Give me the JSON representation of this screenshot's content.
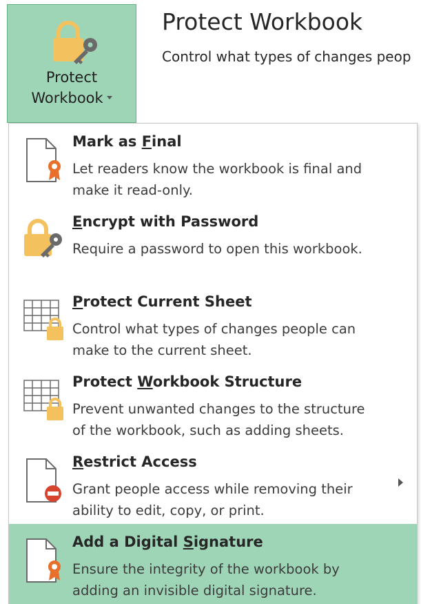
{
  "protect_button": {
    "line1": "Protect",
    "line2": "Workbook",
    "icon": "lock-key-icon",
    "bg_color": "#9fd5b7"
  },
  "header": {
    "title": "Protect Workbook",
    "description": "Control what types of changes peop"
  },
  "menu": {
    "items": [
      {
        "title_pre": "Mark as ",
        "title_key": "F",
        "title_post": "inal",
        "desc": [
          "Let readers know the workbook is final and",
          "make it read-only."
        ],
        "icon": "document-ribbon-icon"
      },
      {
        "title_pre": "",
        "title_key": "E",
        "title_post": "ncrypt with Password",
        "desc": [
          "Require a password to open this workbook."
        ],
        "icon": "lock-key-icon"
      },
      {
        "title_pre": "",
        "title_key": "P",
        "title_post": "rotect Current Sheet",
        "desc": [
          "Control what types of changes people can",
          "make to the current sheet."
        ],
        "icon": "sheet-lock-icon"
      },
      {
        "title_pre": "Protect ",
        "title_key": "W",
        "title_post": "orkbook Structure",
        "desc": [
          "Prevent unwanted changes to the structure",
          "of the workbook, such as adding sheets."
        ],
        "icon": "sheet-lock-icon"
      },
      {
        "title_pre": "",
        "title_key": "R",
        "title_post": "estrict Access",
        "desc": [
          "Grant people access while removing their",
          "ability to edit, copy, or print."
        ],
        "icon": "document-no-entry-icon",
        "has_submenu": true
      },
      {
        "title_pre": "Add a Digital ",
        "title_key": "S",
        "title_post": "ignature",
        "desc": [
          "Ensure the integrity of the workbook by",
          "adding an invisible digital signature."
        ],
        "icon": "document-ribbon-icon",
        "highlighted": true
      }
    ]
  },
  "colors": {
    "highlight": "#9fd5b7",
    "lock_gold": "#f4c15f",
    "ribbon_orange": "#e8702a",
    "no_entry_red": "#d64430"
  }
}
